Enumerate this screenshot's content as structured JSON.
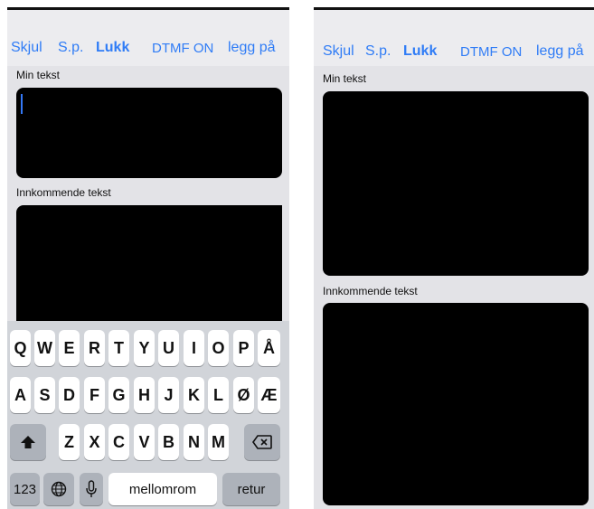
{
  "toolbar": {
    "hide": "Skjul",
    "sp": "S.p.",
    "close": "Lukk",
    "dtmf": "DTMF ON",
    "hangup": "legg på"
  },
  "labels": {
    "my_text": "Min tekst",
    "incoming_text": "Innkommende tekst"
  },
  "keyboard": {
    "row1": [
      "Q",
      "W",
      "E",
      "R",
      "T",
      "Y",
      "U",
      "I",
      "O",
      "P",
      "Å"
    ],
    "row2": [
      "A",
      "S",
      "D",
      "F",
      "G",
      "H",
      "J",
      "K",
      "L",
      "Ø",
      "Æ"
    ],
    "row3": [
      "Z",
      "X",
      "C",
      "V",
      "B",
      "N",
      "M"
    ],
    "numbers": "123",
    "space": "mellomrom",
    "return": "retur"
  },
  "colors": {
    "accent": "#2f7cf6",
    "panel": "#e3e3e7",
    "textbox": "#000000"
  }
}
